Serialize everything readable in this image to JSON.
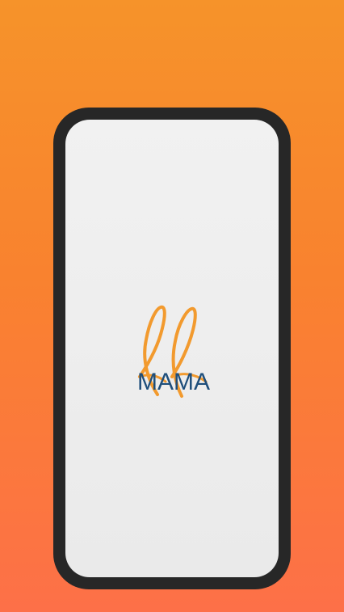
{
  "app": {
    "logo_text": "MAMA",
    "logo_mark_icon": "ribbon-mm-logo-icon"
  },
  "colors": {
    "background_top": "#F6932A",
    "background_bottom": "#FD7048",
    "device_frame": "#272727",
    "screen": "#EEEEEE",
    "logo_orange": "#F29A2E",
    "logo_navy": "#1E4E7B"
  }
}
